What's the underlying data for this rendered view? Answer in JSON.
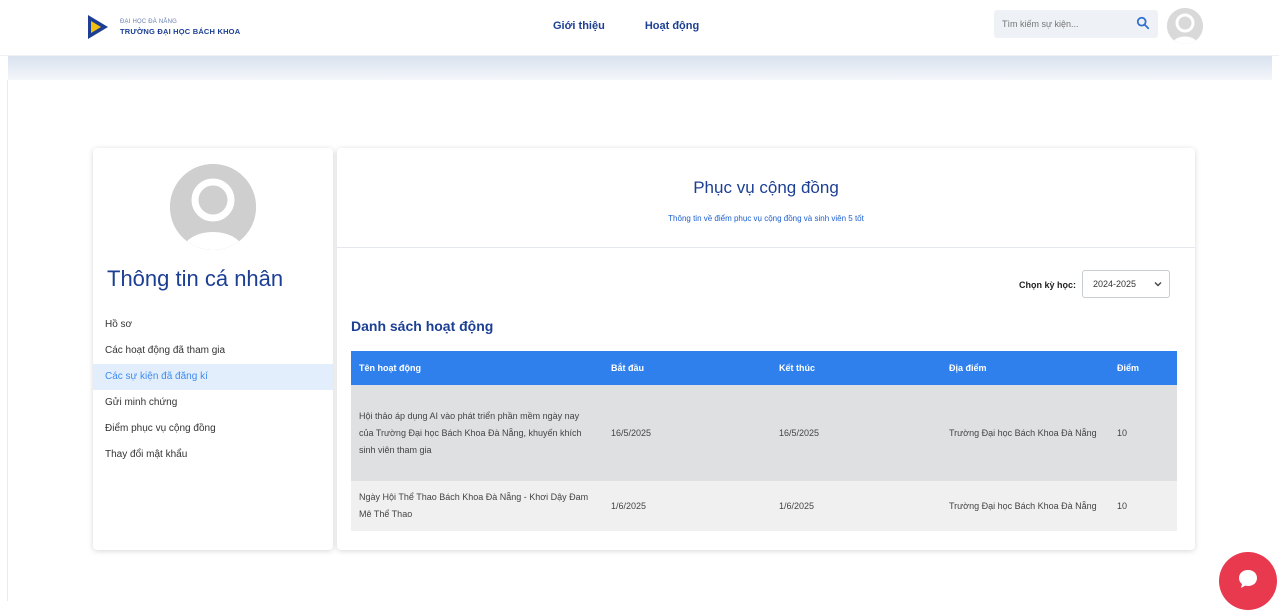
{
  "header": {
    "logo": {
      "line1": "ĐẠI HỌC ĐÀ NẴNG",
      "line2": "TRƯỜNG ĐẠI HỌC BÁCH KHOA"
    },
    "nav": [
      {
        "label": "Giới thiệu"
      },
      {
        "label": "Hoạt động"
      }
    ],
    "search": {
      "placeholder": "Tìm kiếm sự kiện..."
    }
  },
  "sidebar": {
    "title": "Thông tin cá nhân",
    "items": [
      {
        "label": "Hồ sơ"
      },
      {
        "label": "Các hoạt động đã tham gia"
      },
      {
        "label": "Các sự kiện đã đăng kí"
      },
      {
        "label": "Gửi minh chứng"
      },
      {
        "label": "Điểm phục vụ cộng đồng"
      },
      {
        "label": "Thay đổi mật khẩu"
      }
    ]
  },
  "main": {
    "title": "Phục vụ cộng đồng",
    "subtitle": "Thông tin về điểm phục vụ cộng đồng và sinh viên 5 tốt",
    "term_label": "Chọn kỳ học:",
    "term_value": "2024-2025",
    "list_title": "Danh sách hoạt động",
    "table": {
      "headers": [
        "Tên hoạt động",
        "Bắt đầu",
        "Kết thúc",
        "Địa điểm",
        "Điểm"
      ],
      "rows": [
        [
          "Hội thảo áp dụng AI vào phát triển phần mềm ngày nay của Trường Đại học Bách Khoa Đà Nẵng, khuyến khích sinh viên tham gia",
          "16/5/2025",
          "16/5/2025",
          "Trường Đại học Bách Khoa Đà Nẵng",
          "10"
        ],
        [
          "Ngày Hội Thể Thao Bách Khoa Đà Nẵng - Khơi Dậy Đam Mê Thể Thao",
          "1/6/2025",
          "1/6/2025",
          "Trường Đại học Bách Khoa Đà Nẵng",
          "10"
        ]
      ]
    }
  },
  "colors": {
    "brand": "#1c3f94",
    "table_header": "#2f80ed",
    "active_item": "#3d8bf0",
    "chat": "#e9394f"
  },
  "icons": {
    "search": "search-icon",
    "avatar": "user-avatar-icon",
    "dropdown": "chevron-down-icon",
    "chat": "chat-icon"
  }
}
